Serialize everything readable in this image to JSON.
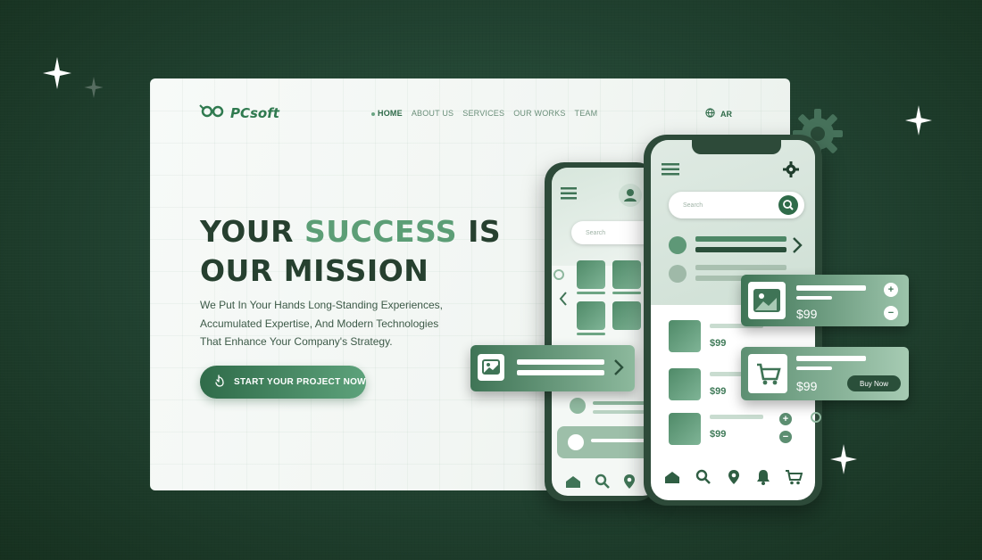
{
  "site": {
    "logo": "PCsoft",
    "nav": [
      "HOME",
      "ABOUT US",
      "SERVICES",
      "OUR WORKS",
      "TEAM"
    ],
    "lang": "AR",
    "hero": {
      "line1_start": "YOUR ",
      "line1_accent": "SUCCESS",
      "line1_end": " IS",
      "line2": "OUR MISSION",
      "subtitle_lines": [
        "We Put In Your Hands Long-Standing Experiences,",
        "Accumulated Expertise, And Modern Technologies",
        "That Enhance Your Company's Strategy."
      ],
      "cta": "START YOUR PROJECT NOW"
    }
  },
  "phones": {
    "search_placeholder": "Search",
    "prices": [
      "$99",
      "$99",
      "$99"
    ]
  },
  "cards": {
    "price_top": "$99",
    "price_cart": "$99",
    "buy_now": "Buy Now"
  },
  "colors": {
    "accent": "#5c9e76",
    "dark_green": "#26402f",
    "background": "#20402f"
  }
}
